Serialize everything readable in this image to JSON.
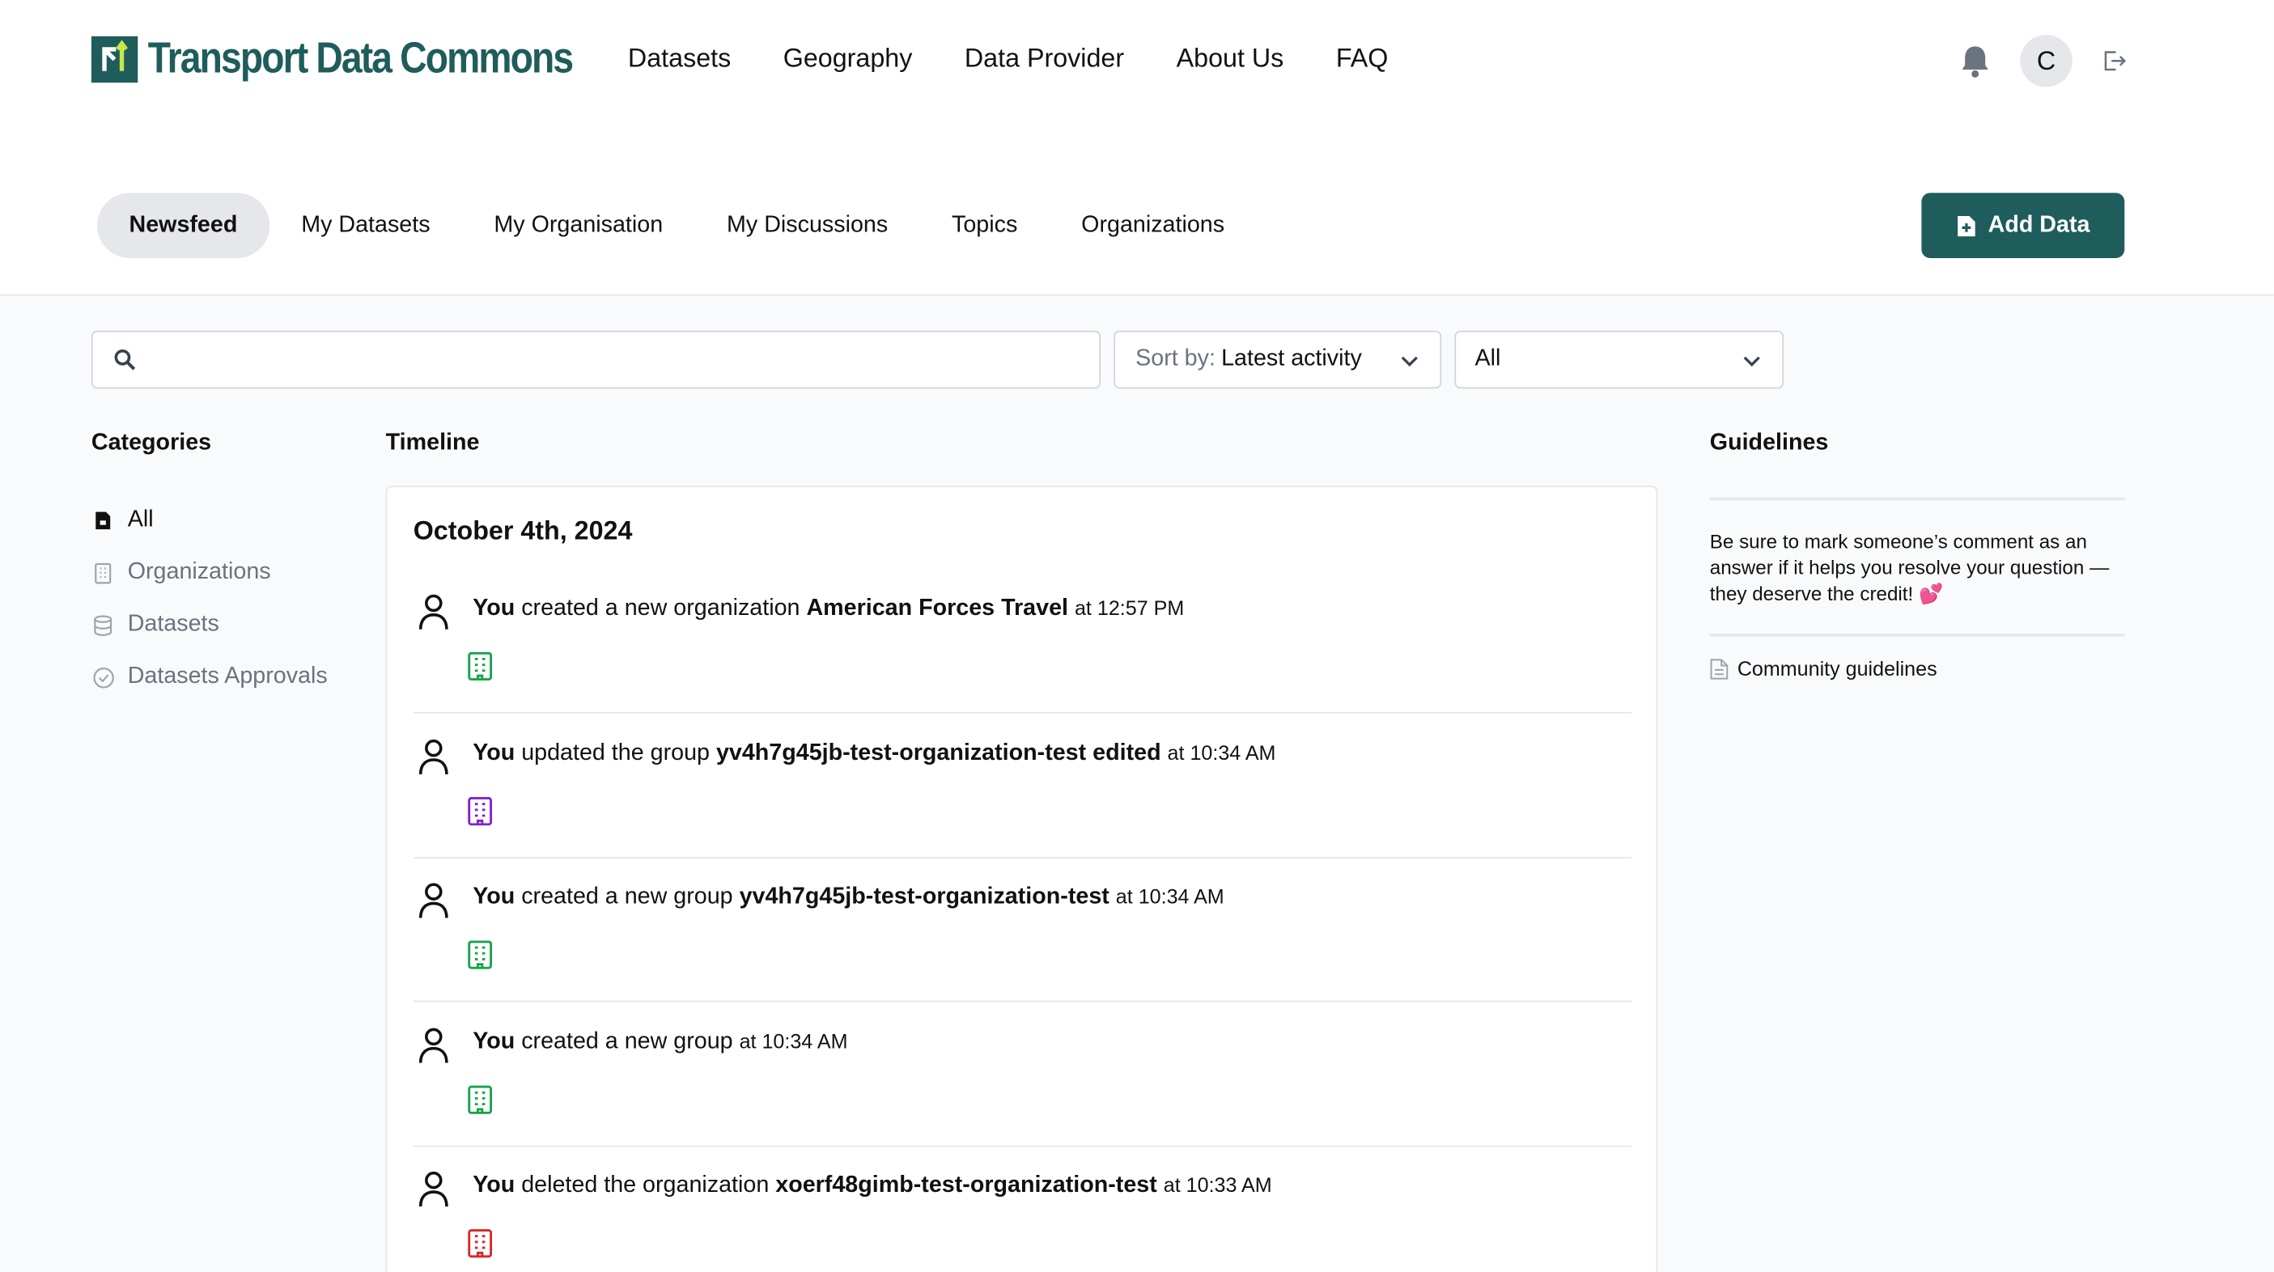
{
  "brand": {
    "name": "Transport Data Commons"
  },
  "main_nav": [
    "Datasets",
    "Geography",
    "Data Provider",
    "About Us",
    "FAQ"
  ],
  "user": {
    "avatar_initial": "C"
  },
  "sub_nav": {
    "tabs": [
      "Newsfeed",
      "My Datasets",
      "My Organisation",
      "My Discussions",
      "Topics",
      "Organizations"
    ],
    "active": "Newsfeed"
  },
  "add_button": "Add Data",
  "search": {
    "placeholder": ""
  },
  "sort": {
    "label": "Sort by:",
    "value": "Latest activity"
  },
  "filter": {
    "value": "All"
  },
  "categories": {
    "title": "Categories",
    "items": [
      {
        "label": "All",
        "icon": "file-icon",
        "active": true
      },
      {
        "label": "Organizations",
        "icon": "building-icon"
      },
      {
        "label": "Datasets",
        "icon": "database-icon"
      },
      {
        "label": "Datasets Approvals",
        "icon": "check-circle-icon"
      }
    ]
  },
  "timeline": {
    "title": "Timeline",
    "date": "October 4th, 2024",
    "items": [
      {
        "actor": "You",
        "action": "created a new organization",
        "target": "American Forces Travel",
        "time": "at 12:57 PM",
        "icon_color": "#16a34a"
      },
      {
        "actor": "You",
        "action": "updated the group",
        "target": "yv4h7g45jb-test-organization-test edited",
        "time": "at 10:34 AM",
        "icon_color": "#7e22ce"
      },
      {
        "actor": "You",
        "action": "created a new group",
        "target": "yv4h7g45jb-test-organization-test",
        "time": "at 10:34 AM",
        "icon_color": "#16a34a"
      },
      {
        "actor": "You",
        "action": "created a new group",
        "target": "",
        "time": "at 10:34 AM",
        "icon_color": "#16a34a"
      },
      {
        "actor": "You",
        "action": "deleted the organization",
        "target": "xoerf48gimb-test-organization-test",
        "time": "at 10:33 AM",
        "icon_color": "#dc2626"
      }
    ]
  },
  "guidelines": {
    "title": "Guidelines",
    "text": "Be sure to mark someone’s comment as an answer if it helps you resolve your question — they deserve the credit! 💕",
    "link": "Community guidelines"
  },
  "colors": {
    "brand": "#1f5c5c",
    "accent": "#c8e64a"
  }
}
